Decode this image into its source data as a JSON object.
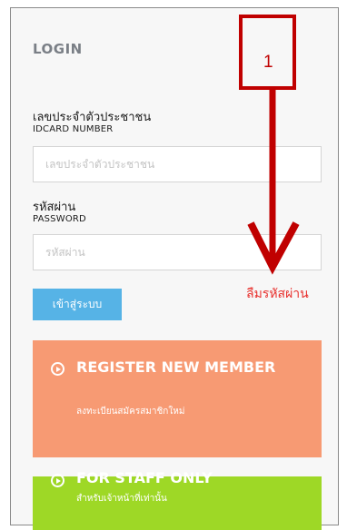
{
  "login": {
    "title": "LOGIN",
    "idcard": {
      "label_th": "เลขประจำตัวประชาชน",
      "label_en": "IDCARD NUMBER",
      "placeholder": "เลขประจำตัวประชาชน",
      "value": ""
    },
    "password": {
      "label_th": "รหัสผ่าน",
      "label_en": "PASSWORD",
      "placeholder": "รหัสผ่าน",
      "value": ""
    },
    "submit_label": "เข้าสู่ระบบ",
    "forgot_label": "ลืมรหัสผ่าน"
  },
  "register": {
    "title": "REGISTER NEW MEMBER",
    "subtitle": "ลงทะเบียนสมัครสมาชิกใหม่",
    "icon": "play-circle-icon"
  },
  "staff": {
    "title": "FOR STAFF ONLY",
    "subtitle": "สำหรับเจ้าหน้าที่เท่านั้น",
    "icon": "play-circle-icon"
  },
  "annotation": {
    "number": "1",
    "color": "#c00000"
  },
  "colors": {
    "login_button": "#56b3e6",
    "forgot_link": "#e8302d",
    "register_card": "#f79a73",
    "staff_card": "#9ed826"
  }
}
